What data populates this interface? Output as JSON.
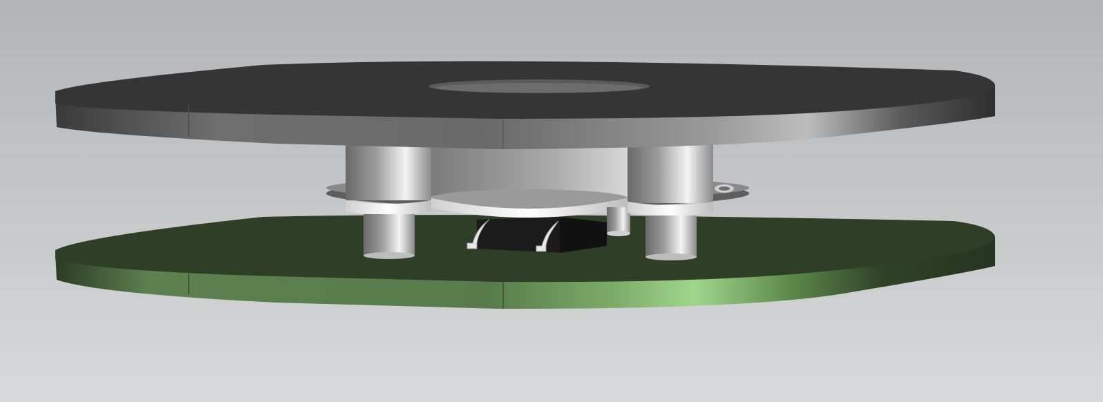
{
  "scene": {
    "description_visible_text": "",
    "colors": {
      "background_top": "#b5b6b8",
      "background_bottom": "#d7d8d9",
      "top_plate": "#353535",
      "pcb": "#2f3e26",
      "pcb_edge_highlight": "#9ed08a",
      "metal_light": "#f2f2f2",
      "metal_dark": "#707070",
      "chip": "#1b1b1b"
    }
  }
}
